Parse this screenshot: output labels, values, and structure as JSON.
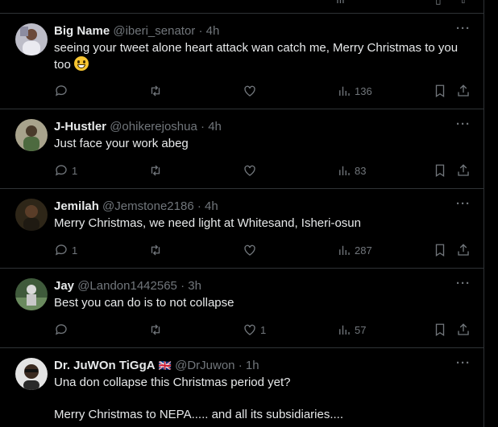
{
  "tweets": [
    {
      "name": "Big Name",
      "handle": "@iberi_senator",
      "time": "4h",
      "text": "seeing your tweet alone heart attack wan catch me, Merry Christmas to you too",
      "replies": "",
      "likes": "",
      "views": "136",
      "avatar_color": "#c9c9d2"
    },
    {
      "name": "J-Hustler",
      "handle": "@ohikerejoshua",
      "time": "4h",
      "text": "Just face your work abeg",
      "replies": "1",
      "likes": "",
      "views": "83",
      "avatar_color": "#8f8a78"
    },
    {
      "name": "Jemilah",
      "handle": "@Jemstone2186",
      "time": "4h",
      "text": "Merry Christmas, we need light at Whitesand, Isheri-osun",
      "replies": "1",
      "likes": "",
      "views": "287",
      "avatar_color": "#3a3020"
    },
    {
      "name": "Jay",
      "handle": "@Landon1442565",
      "time": "3h",
      "text": "Best you can do is to not collapse",
      "replies": "",
      "likes": "1",
      "views": "57",
      "avatar_color": "#4f6a4c"
    },
    {
      "name": "Dr. JuWOn TiGgA",
      "handle": "@DrJuwon",
      "time": "1h",
      "text": "Una don collapse this Christmas period yet?",
      "text2": "Merry Christmas to NEPA..... and all its subsidiaries....",
      "avatar_color": "#d8d8d8"
    }
  ],
  "separator": "·",
  "more_glyph": "···",
  "flag": "🇬🇧",
  "colors": {
    "bg": "#000000",
    "text": "#e7e9ea",
    "muted": "#71767b",
    "border": "#2f3336"
  }
}
